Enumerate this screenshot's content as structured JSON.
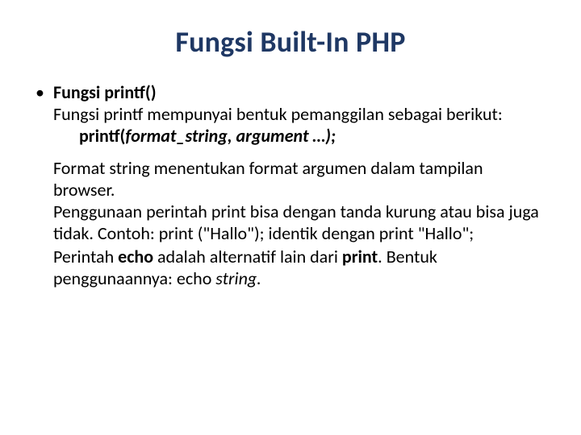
{
  "title": "Fungsi Built-In PHP",
  "bullet": "•",
  "item": {
    "heading": "Fungsi printf()",
    "line1": "Fungsi printf mempunyai bentuk pemanggilan sebagai berikut:",
    "sig_prefix": "printf(",
    "sig_args": "format_string, argument …);",
    "para2a": "Format string menentukan format argumen dalam tampilan browser.",
    "para2b": "Penggunaan perintah print bisa dengan tanda kurung atau bisa juga tidak. Contoh: print (\"Hallo\"); identik dengan print \"Hallo\";",
    "para3_a": "Perintah ",
    "para3_b": "echo",
    "para3_c": " adalah alternatif lain dari ",
    "para3_d": "print",
    "para3_e": ". Bentuk penggunaannya: echo ",
    "para3_f": "string",
    "para3_g": "."
  }
}
